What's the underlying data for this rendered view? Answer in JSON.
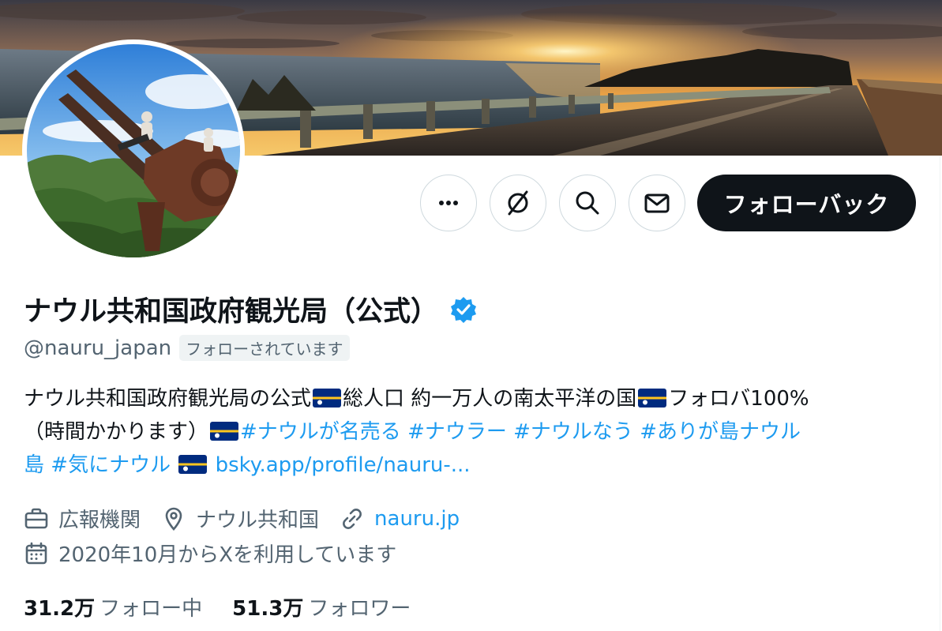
{
  "profile": {
    "display_name": "ナウル共和国政府観光局（公式）",
    "handle": "@nauru_japan",
    "follows_you": "フォローされています",
    "verified": true
  },
  "actions": {
    "more_icon": "ellipsis-icon",
    "grok_icon": "grok-icon",
    "search_icon": "search-icon",
    "mail_icon": "mail-icon",
    "follow_back_label": "フォローバック"
  },
  "bio": {
    "line1_text1": "ナウル共和国政府観光局の公式",
    "line1_text2": "総人口 約一万人の南太平洋の国",
    "line1_text3": "フォロバ100%",
    "line2_text1": "（時間かかります）",
    "hashtag1": "#ナウルが名売る",
    "hashtag2": "#ナウラー",
    "hashtag3": "#ナウルなう",
    "hashtag4": "#ありが島ナウル",
    "line3_prefix": "島",
    "hashtag5": "#気にナウル",
    "bsky_link": "bsky.app/profile/nauru-..."
  },
  "meta": {
    "category_icon": "briefcase-icon",
    "category": "広報機関",
    "location_icon": "location-pin-icon",
    "location": "ナウル共和国",
    "website_icon": "link-icon",
    "website": "nauru.jp",
    "joined_icon": "calendar-icon",
    "joined": "2020年10月からXを利用しています"
  },
  "stats": {
    "following_count": "31.2万",
    "following_label": "フォロー中",
    "followers_count": "51.3万",
    "followers_label": "フォロワー"
  },
  "colors": {
    "accent": "#1d9bf0",
    "text_primary": "#0f1419",
    "text_secondary": "#536471",
    "button_dark": "#0f1419"
  }
}
